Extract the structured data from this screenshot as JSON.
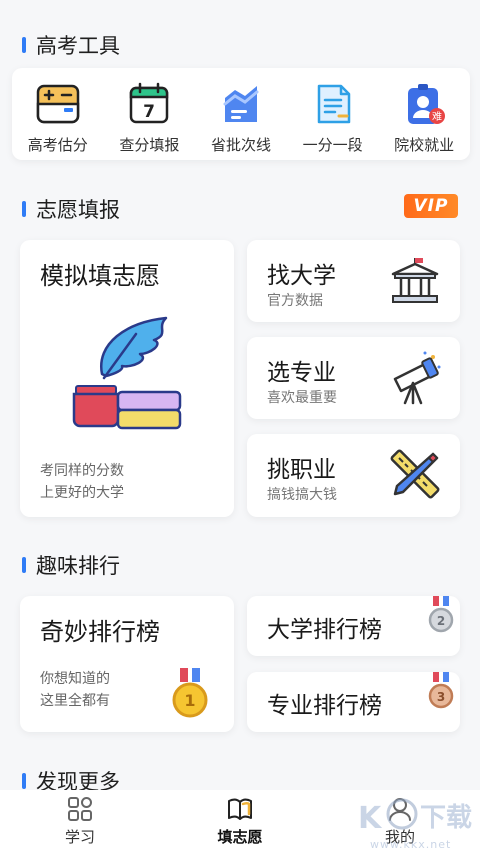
{
  "sections": {
    "tools": "高考工具",
    "volunteer": "志愿填报",
    "fun_rank": "趣味排行",
    "discover": "发现更多"
  },
  "tools": [
    {
      "label": "高考估分",
      "icon": "calculator-icon"
    },
    {
      "label": "查分填报",
      "icon": "calendar-icon"
    },
    {
      "label": "省批次线",
      "icon": "chart-line-icon"
    },
    {
      "label": "一分一段",
      "icon": "document-icon"
    },
    {
      "label": "院校就业",
      "icon": "id-badge-icon"
    }
  ],
  "vip": "VIP",
  "mock_fill": {
    "title": "模拟填志愿",
    "desc_line1": "考同样的分数",
    "desc_line2": "上更好的大学"
  },
  "find_university": {
    "title": "找大学",
    "sub": "官方数据"
  },
  "choose_major": {
    "title": "选专业",
    "sub": "喜欢最重要"
  },
  "pick_career": {
    "title": "挑职业",
    "sub": "搞钱搞大钱"
  },
  "rank_fun": {
    "title": "奇妙排行榜",
    "desc_line1": "你想知道的",
    "desc_line2": "这里全都有"
  },
  "rank_university": {
    "title": "大学排行榜"
  },
  "rank_major": {
    "title": "专业排行榜"
  },
  "badges": {
    "hard": "难"
  },
  "medals": {
    "gold": "1",
    "silver": "2",
    "bronze": "3"
  },
  "bottom_nav": [
    {
      "label": "学习",
      "icon": "grid-icon"
    },
    {
      "label": "填志愿",
      "icon": "book-icon"
    },
    {
      "label": "我的",
      "icon": "user-icon"
    }
  ],
  "watermark": {
    "brand": "KK下载",
    "url": "www.kkx.net"
  },
  "colors": {
    "accent": "#2f7cf6",
    "vip": "#ff6a1a",
    "background": "#f6f7f9"
  }
}
